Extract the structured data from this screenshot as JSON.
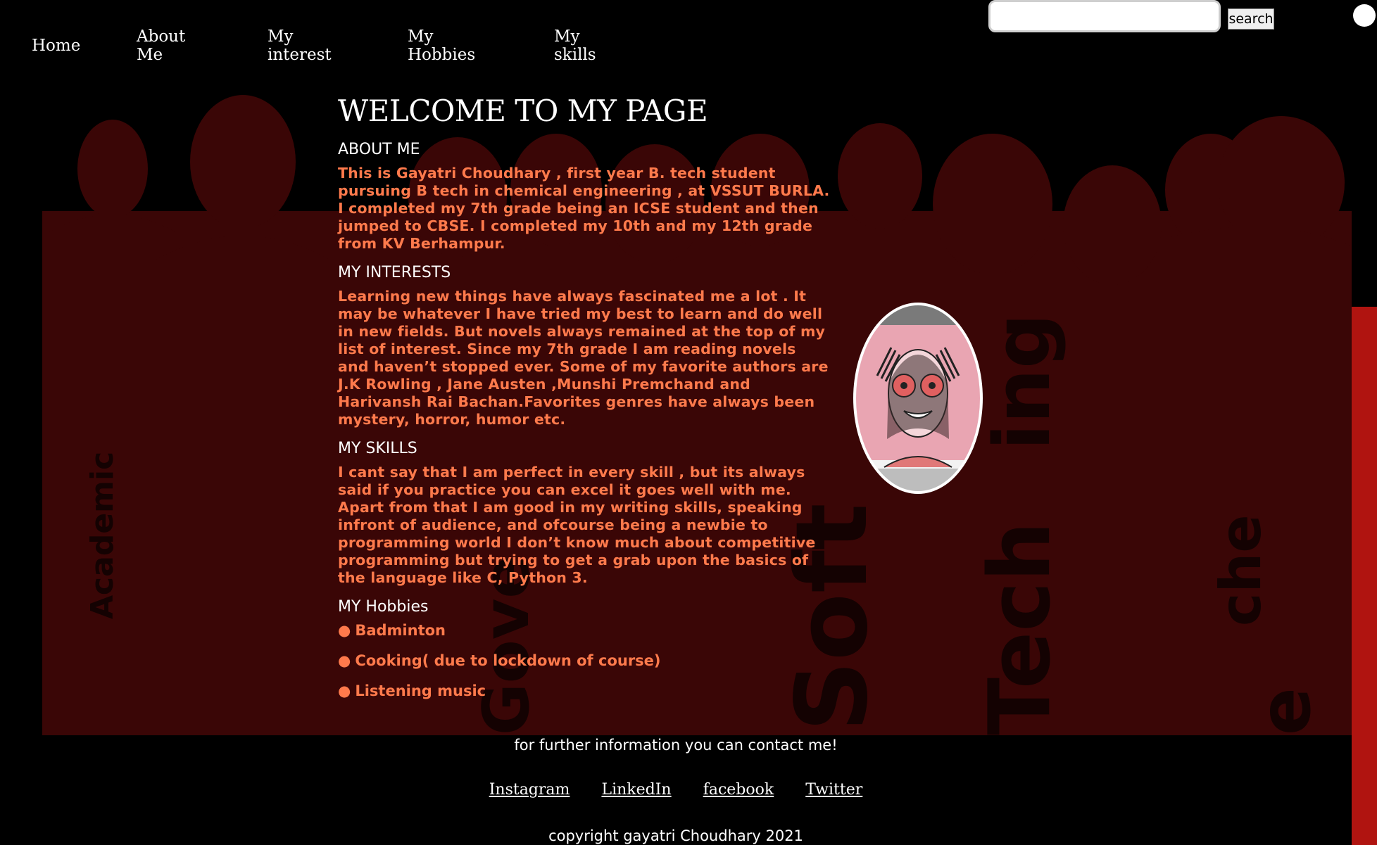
{
  "nav": {
    "home": "Home",
    "about_line1": "About",
    "about_line2": "Me",
    "interest_line1": "My",
    "interest_line2": "interest",
    "hobbies_line1": "My",
    "hobbies_line2": "Hobbies",
    "skills_line1": "My",
    "skills_line2": "skills"
  },
  "search": {
    "placeholder": "",
    "button_label": "search"
  },
  "main": {
    "title": "WELCOME TO MY PAGE",
    "about_heading": "ABOUT ME",
    "about_text": "This is Gayatri Choudhary , first year B. tech student pursuing B tech in chemical engineering , at VSSUT BURLA. I completed my 7th grade being an ICSE student and then jumped to CBSE. I completed my 10th and my 12th grade from KV Berhampur.",
    "interests_heading": "MY INTERESTS",
    "interests_text": "Learning new things have always fascinated me a lot . It may be whatever I have tried my best to learn and do well in new fields. But novels always remained at the top of my list of interest. Since my 7th grade I am reading novels and haven’t stopped ever. Some of my favorite authors are J.K Rowling , Jane Austen ,Munshi Premchand and Harivansh Rai Bachan.Favorites genres have always been mystery, horror, humor etc.",
    "skills_heading": "MY SKILLS",
    "skills_text": "I cant say that I am perfect in every skill , but its always said if you practice you can excel it goes well with me. Apart from that I am good in my writing skills, speaking infront of audience, and ofcourse being a newbie to programming world I don’t know much about competitive programming but trying to get a grab upon the basics of the language like C, Python 3.",
    "hobbies_heading": "MY Hobbies",
    "hobbies": [
      "Badminton",
      "Cooking( due to lockdown of course)",
      "Listening music"
    ]
  },
  "background_words": [
    "Academic",
    "Gove",
    "Soft",
    "Tech",
    "che",
    "ing",
    "e"
  ],
  "footer": {
    "note": "for further information you can contact me!",
    "links": [
      "Instagram",
      "LinkedIn",
      "facebook",
      "Twitter"
    ],
    "copyright": "copyright gayatri Choudhary 2021"
  },
  "colors": {
    "background": "#000000",
    "silhouette": "#3a0606",
    "text_accent": "#ff7a4c",
    "edge_red": "#b01410"
  }
}
